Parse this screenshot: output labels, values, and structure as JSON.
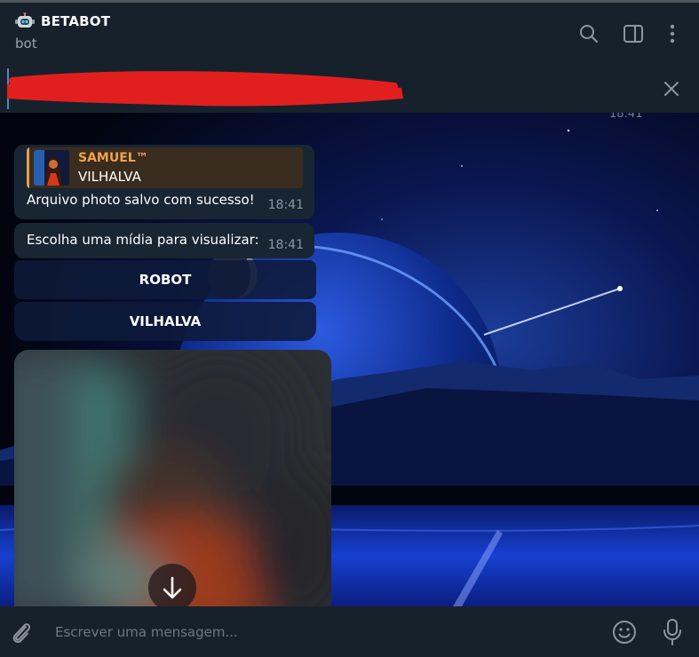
{
  "header": {
    "title": "BETABOT",
    "subtitle": "bot",
    "icons": [
      "search-icon",
      "sidebar-toggle-icon",
      "more-vertical-icon"
    ]
  },
  "pinned": {
    "time_partial": "18:41"
  },
  "messages": [
    {
      "reply_name": "SAMUEL™",
      "reply_text": "VILHALVA",
      "text": "Arquivo photo salvo com sucesso!",
      "time": "18:41"
    },
    {
      "text": "Escolha uma mídia para visualizar:",
      "time": "18:41"
    }
  ],
  "keyboard": {
    "buttons": [
      "ROBOT",
      "VILHALVA"
    ]
  },
  "composer": {
    "placeholder": "Escrever uma mensagem..."
  },
  "colors": {
    "panel": "#17212b",
    "bubble": "#182533",
    "reply_accent": "#f0a24e",
    "redaction": "#e21f1f"
  }
}
